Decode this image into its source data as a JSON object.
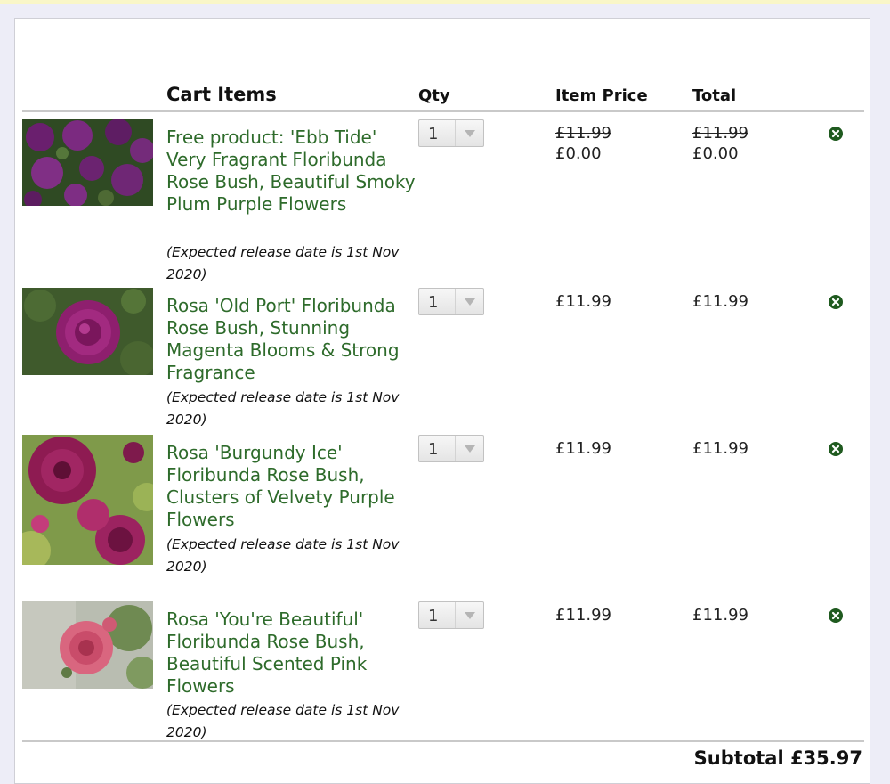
{
  "header": {
    "cart_items": "Cart Items",
    "qty": "Qty",
    "item_price": "Item Price",
    "total": "Total"
  },
  "items": [
    {
      "name": "Free product: 'Ebb Tide' Very Fragrant Floribunda Rose Bush, Beautiful Smoky Plum Purple Flowers",
      "release": "(Expected release date is 1st Nov 2020)",
      "qty": "1",
      "old_price": "£11.99",
      "price": "£0.00",
      "old_total": "£11.99",
      "total": "£0.00"
    },
    {
      "name": "Rosa 'Old Port' Floribunda Rose Bush, Stunning Magenta Blooms & Strong Fragrance",
      "release": "(Expected release date is 1st Nov 2020)",
      "qty": "1",
      "price": "£11.99",
      "total": "£11.99"
    },
    {
      "name": "Rosa 'Burgundy Ice' Floribunda Rose Bush, Clusters of Velvety Purple Flowers",
      "release": "(Expected release date is 1st Nov 2020)",
      "qty": "1",
      "price": "£11.99",
      "total": "£11.99"
    },
    {
      "name": "Rosa 'You're Beautiful' Floribunda Rose Bush, Beautiful Scented Pink Flowers",
      "release": "(Expected release date is 1st Nov 2020)",
      "qty": "1",
      "price": "£11.99",
      "total": "£11.99"
    }
  ],
  "subtotal": "Subtotal £35.97",
  "colors": {
    "link_green": "#2e6b2b",
    "remove_green": "#1f5a1f"
  },
  "icons": {
    "remove": "close-circle-icon",
    "dropdown": "chevron-down-icon"
  }
}
